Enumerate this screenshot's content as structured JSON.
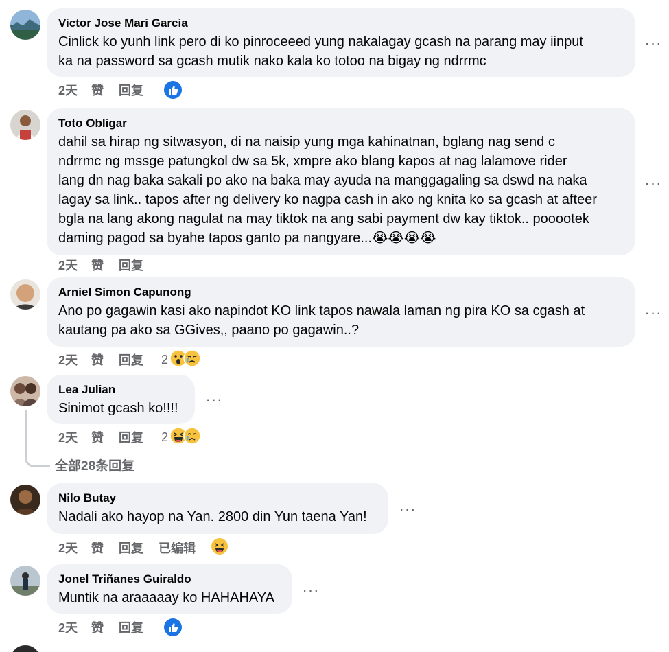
{
  "comments": [
    {
      "author": "Victor Jose Mari Garcia",
      "text": "Cinlick ko yunh link pero di ko pinroceeed yung nakalagay gcash na parang may iinput\nka na password sa gcash mutik nako kala ko totoo na bigay ng ndrrmc",
      "time": "2天",
      "like": "赞",
      "reply": "回复",
      "reaction_count": ""
    },
    {
      "author": "Toto Obligar",
      "text": "dahil sa hirap ng sitwasyon, di na naisip yung mga kahinatnan, bglang nag send c\nndrrmc ng mssge patungkol dw sa 5k, xmpre ako blang kapos at nag lalamove rider\nlang dn nag baka sakali po ako na baka may ayuda na manggagaling sa dswd na naka\nlagay sa link.. tapos after ng delivery ko nagpa cash in ako ng knita ko sa gcash at afteer\nbgla na lang akong nagulat na may tiktok na ang sabi payment dw kay tiktok.. pooootek\ndaming pagod sa byahe tapos ganto pa nangyare...😭😭😭😭",
      "time": "2天",
      "like": "赞",
      "reply": "回复",
      "reaction_count": ""
    },
    {
      "author": "Arniel Simon Capunong",
      "text": "Ano po gagawin kasi ako napindot KO link tapos nawala laman ng pira KO sa cgash at\nkautang pa ako sa GGives,, paano po gagawin..?",
      "time": "2天",
      "like": "赞",
      "reply": "回复",
      "reaction_count": "2"
    },
    {
      "author": "Lea Julian",
      "text": "Sinimot gcash ko!!!!",
      "time": "2天",
      "like": "赞",
      "reply": "回复",
      "reaction_count": "2"
    },
    {
      "author": "Nilo Butay",
      "text": "Nadali ako hayop na Yan. 2800 din Yun taena Yan!",
      "time": "2天",
      "like": "赞",
      "reply": "回复",
      "edited": "已编辑",
      "reaction_count": ""
    },
    {
      "author": "Jonel Triñanes Guiraldo",
      "text": "Muntik na araaaaay ko HAHAHAYA",
      "time": "2天",
      "like": "赞",
      "reply": "回复",
      "reaction_count": ""
    }
  ],
  "view_all_replies": "全部28条回复",
  "more_icon": "···",
  "icons": {
    "like": "like-reaction-icon",
    "cry": "crying-reaction-icon",
    "wow": "wow-reaction-icon",
    "haha": "haha-reaction-icon"
  },
  "colors": {
    "bubble": "#f0f2f5",
    "meta": "#65676b",
    "like_blue": "#1b74e4",
    "emoji_yellow": "#f7c33e"
  }
}
